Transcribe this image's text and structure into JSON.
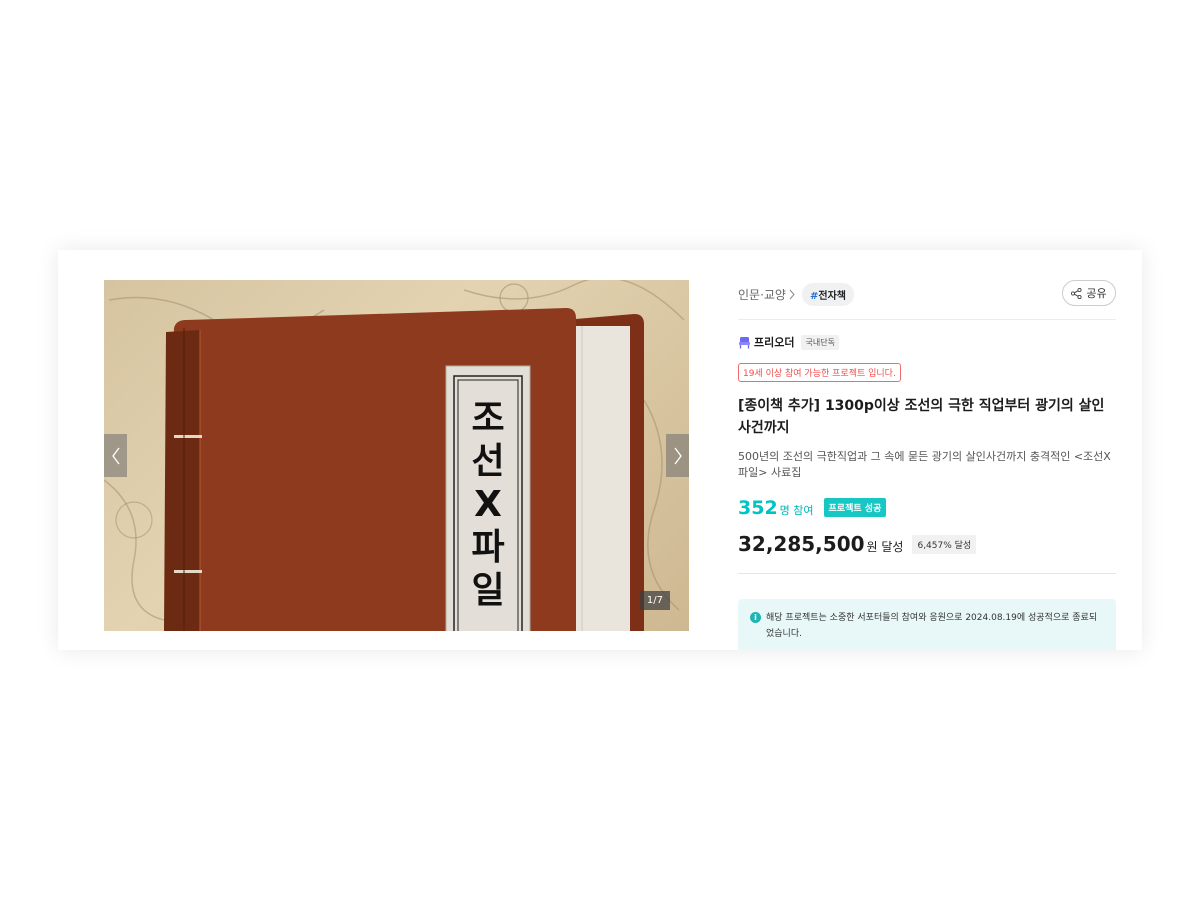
{
  "gallery": {
    "cover_title_chars": [
      "조",
      "선",
      "X",
      "파",
      "일"
    ],
    "counter": "1/7",
    "prev_icon": "chevron-left-icon",
    "next_icon": "chevron-right-icon"
  },
  "breadcrumb": {
    "category": "인문·교양",
    "tag_hash": "#",
    "tag_label": "전자책"
  },
  "share": {
    "label": "공유",
    "icon": "share-icon"
  },
  "maker": {
    "name": "프리오더",
    "badge": "국내단독",
    "icon": "maker-chair-icon",
    "icon_color": "#6a6af5"
  },
  "project": {
    "age_notice": "19세 이상 참여 가능한 프로젝트 입니다.",
    "title": "[종이책 추가] 1300p이상 조선의 극한 직업부터 광기의 살인사건까지",
    "subtitle": "500년의 조선의 극한직업과 그 속에 묻든 광기의 살인사건까지 충격적인 <조선X파일> 사료집",
    "participants": "352",
    "participants_unit": "명 참여",
    "status_badge": "프로젝트 성공",
    "amount": "32,285,500",
    "amount_unit": "원 달성",
    "percent": "6,457% 달성"
  },
  "notice": {
    "icon": "info-icon",
    "text": "해당 프로젝트는 소중한 서포터들의 참여와 응원으로 2024.08.19에 성공적으로 종료되었습니다."
  },
  "colors": {
    "accent": "#00c4c4",
    "success_badge": "#16c7c4",
    "age_border": "#f26b6b",
    "notice_bg": "#e8f8f8",
    "tag_hash": "#2a6fd6"
  }
}
